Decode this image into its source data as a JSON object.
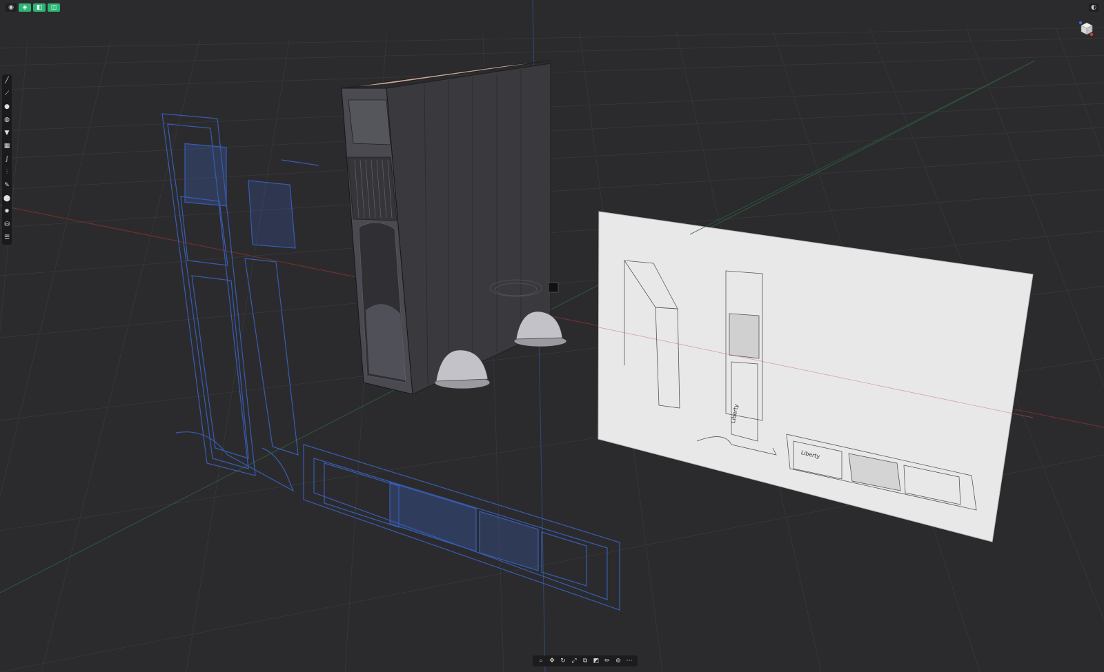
{
  "app": {
    "accent_color": "#2bb673",
    "background_color": "#2b2b2d"
  },
  "top_left": {
    "view_menu_icon": "eye-icon",
    "mode_buttons": [
      {
        "name": "solid-mode-button",
        "icon": "shield-icon"
      },
      {
        "name": "object-mode-button",
        "icon": "cube-icon"
      },
      {
        "name": "component-mode-button",
        "icon": "box-icon"
      }
    ]
  },
  "top_right": {
    "icon": "half-circle-icon"
  },
  "nav_cube": {
    "icon": "view-cube-icon"
  },
  "left_toolbar": {
    "tools": [
      {
        "name": "line-tool",
        "icon": "line-icon"
      },
      {
        "name": "polyline-tool",
        "icon": "polyline-icon"
      },
      {
        "name": "circle-tool",
        "icon": "circle-icon"
      },
      {
        "name": "sphere-tool",
        "icon": "sphere-icon"
      },
      {
        "name": "cup-tool",
        "icon": "cup-icon"
      },
      {
        "name": "grid-tool",
        "icon": "grid-icon"
      },
      {
        "name": "curve-tool",
        "icon": "curve-icon"
      },
      {
        "name": "split-tool",
        "icon": "split-icon"
      },
      {
        "name": "pen-tool",
        "icon": "pen-icon"
      },
      {
        "name": "solid-sphere-tool",
        "icon": "solid-sphere-icon"
      },
      {
        "name": "gear-tool",
        "icon": "gear-icon"
      },
      {
        "name": "cylinder-tool",
        "icon": "cylinder-icon"
      },
      {
        "name": "stack-tool",
        "icon": "stack-icon"
      }
    ]
  },
  "bottom_toolbar": {
    "tools": [
      {
        "name": "search-tool",
        "icon": "search-icon"
      },
      {
        "name": "move-tool",
        "icon": "move-icon"
      },
      {
        "name": "rotate-tool",
        "icon": "rotate-icon"
      },
      {
        "name": "scale-tool",
        "icon": "scale-icon"
      },
      {
        "name": "copy-tool",
        "icon": "copy-icon"
      },
      {
        "name": "duplicate-tool",
        "icon": "duplicate-icon"
      },
      {
        "name": "pencil-tool",
        "icon": "pencil-icon"
      },
      {
        "name": "boolean-tool",
        "icon": "boolean-icon"
      },
      {
        "name": "more-tool",
        "icon": "more-icon"
      }
    ]
  },
  "reference_image": {
    "label_top": "Liberty",
    "label_bottom": "Liberty"
  }
}
